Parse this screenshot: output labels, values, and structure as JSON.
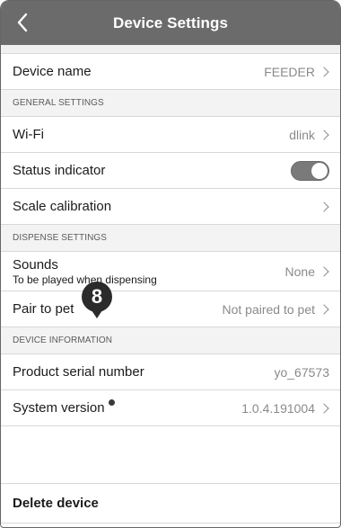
{
  "header": {
    "title": "Device Settings",
    "back_icon": "chevron-left-icon"
  },
  "device_name": {
    "label": "Device name",
    "value": "FEEDER"
  },
  "general_settings": {
    "section_title": "GENERAL SETTINGS",
    "wifi": {
      "label": "Wi-Fi",
      "value": "dlink"
    },
    "status_indicator": {
      "label": "Status indicator",
      "toggle_on": true
    },
    "scale_calibration": {
      "label": "Scale calibration"
    }
  },
  "dispense_settings": {
    "section_title": "DISPENSE SETTINGS",
    "sounds": {
      "label": "Sounds",
      "sublabel": "To be played when dispensing",
      "value": "None"
    },
    "pair_to_pet": {
      "label": "Pair to pet",
      "value": "Not paired to pet"
    }
  },
  "device_information": {
    "section_title": "DEVICE INFORMATION",
    "serial": {
      "label": "Product serial number",
      "value": "yo_67573"
    },
    "system_version": {
      "label": "System version",
      "value": "1.0.4.191004"
    }
  },
  "delete": {
    "label": "Delete device"
  },
  "callout": {
    "number": "8"
  },
  "colors": {
    "header_bg": "#6b6b6b",
    "toggle_on": "#7a7a7a",
    "section_bg": "#f3f3f3"
  }
}
